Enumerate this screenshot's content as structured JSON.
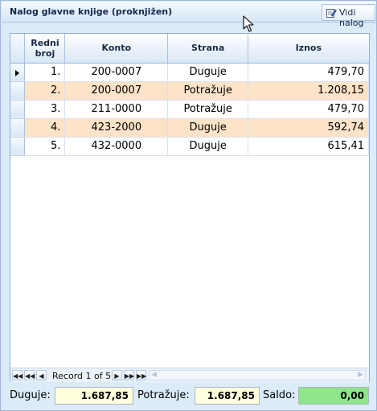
{
  "window": {
    "title": "Nalog glavne knjige (proknjižen)",
    "button_label": "Vidi nalog"
  },
  "icons": {
    "vidi_nalog": "edit-document-icon",
    "cursor": "mouse-pointer-icon",
    "row_indicator": "current-row-arrow-icon"
  },
  "grid": {
    "columns": [
      "Redni broj",
      "Konto",
      "Strana",
      "Iznos"
    ],
    "rows": [
      {
        "redni": "1.",
        "konto": "200-0007",
        "strana": "Duguje",
        "iznos": "479,70"
      },
      {
        "redni": "2.",
        "konto": "200-0007",
        "strana": "Potražuje",
        "iznos": "1.208,15"
      },
      {
        "redni": "3.",
        "konto": "211-0000",
        "strana": "Potražuje",
        "iznos": "479,70"
      },
      {
        "redni": "4.",
        "konto": "423-2000",
        "strana": "Duguje",
        "iznos": "592,74"
      },
      {
        "redni": "5.",
        "konto": "432-0000",
        "strana": "Duguje",
        "iznos": "615,41"
      }
    ],
    "row_colors": {
      "alt": "#fde3c7",
      "normal": "#ffffff"
    }
  },
  "navigator": {
    "record_text": "Record 1 of 5"
  },
  "footer": {
    "duguje_label": "Duguje:",
    "duguje_value": "1.687,85",
    "potrazuje_label": "Potražuje:",
    "potrazuje_value": "1.687,85",
    "saldo_label": "Saldo:",
    "saldo_value": "0,00",
    "colors": {
      "total_box": "#ffffde",
      "saldo_box": "#8ee58a"
    }
  }
}
